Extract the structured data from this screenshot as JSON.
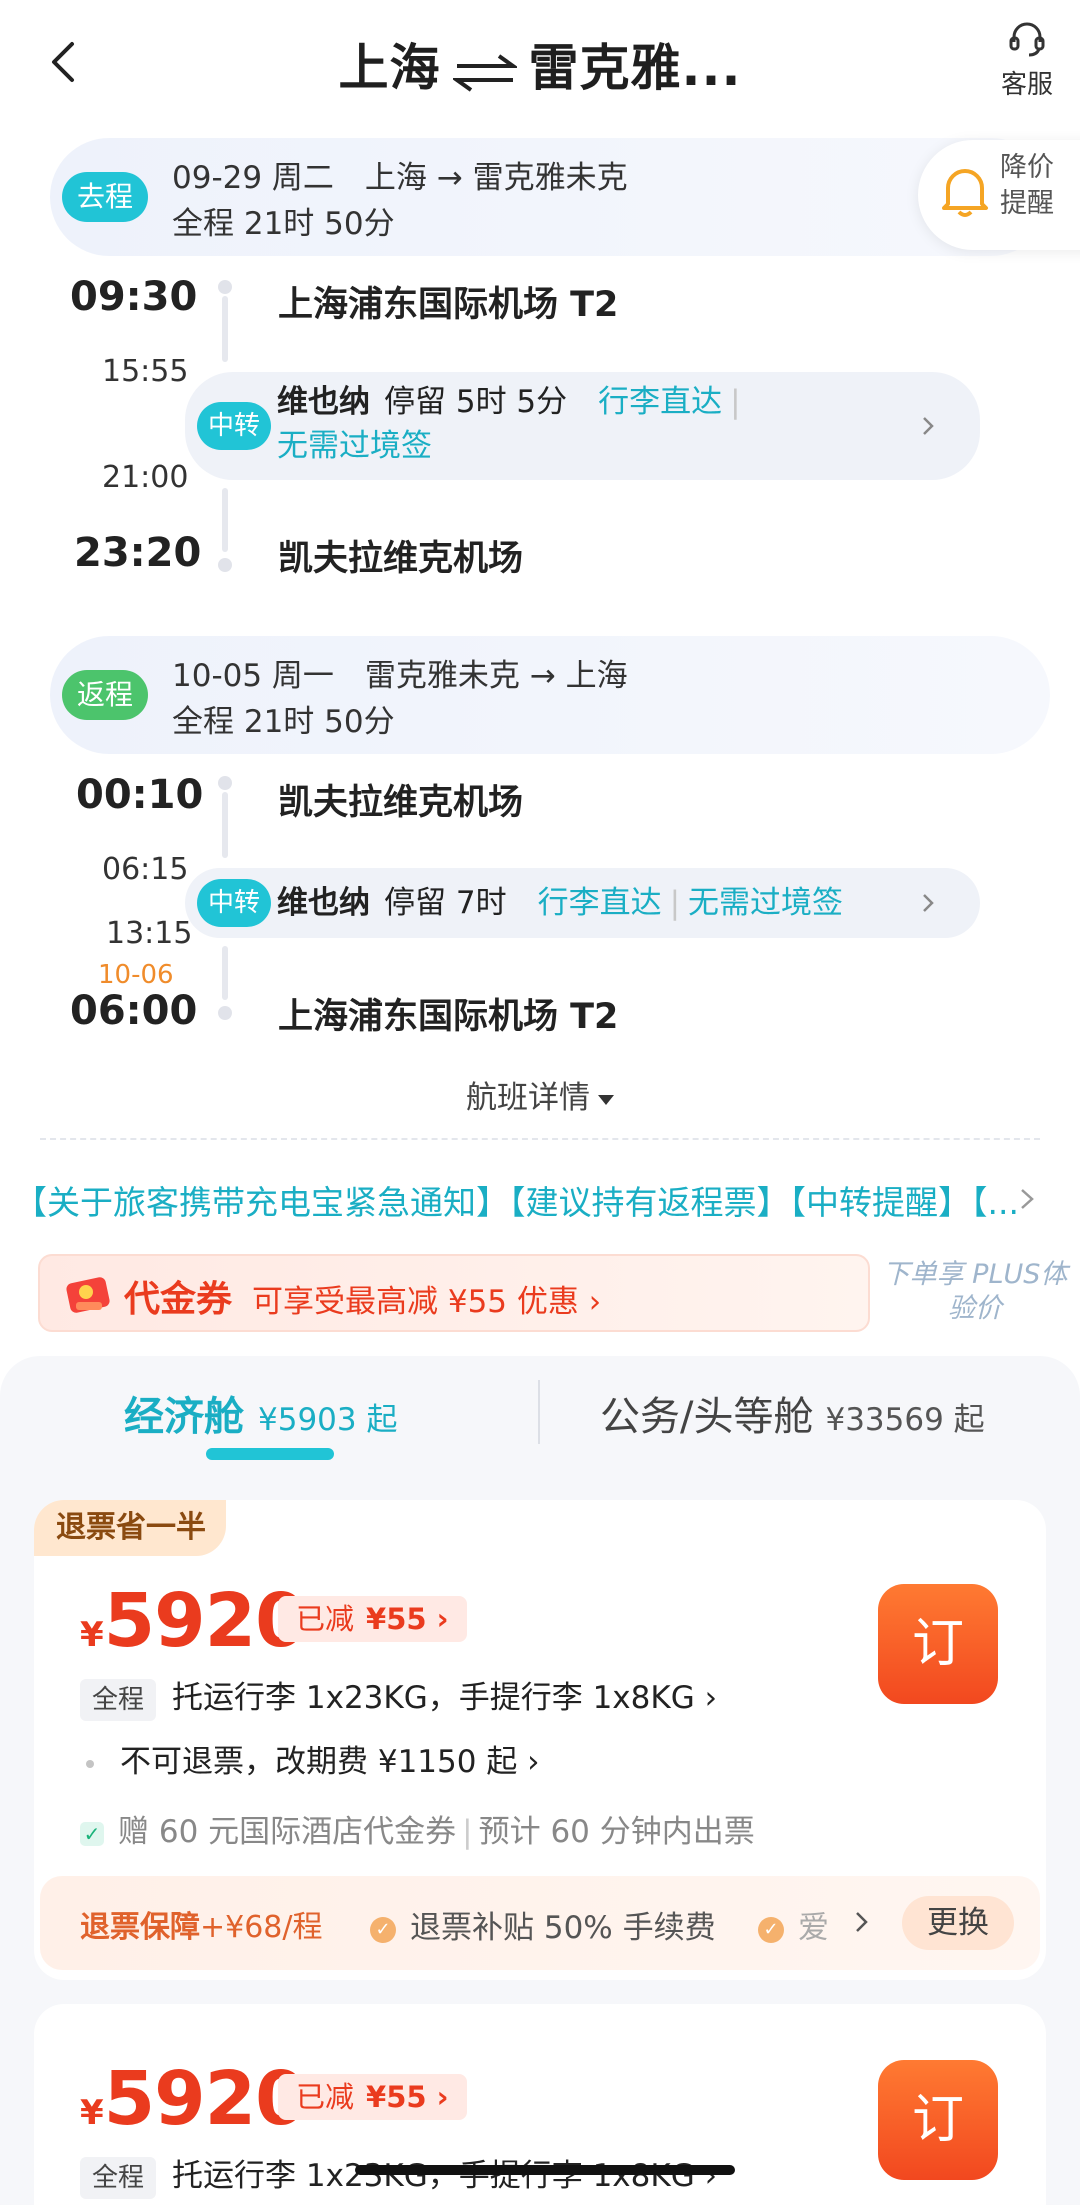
{
  "header": {
    "title_from": "上海",
    "title_to": "雷克雅...",
    "service_label": "客服"
  },
  "price_alert": {
    "label": "降价提醒"
  },
  "outbound": {
    "badge": "去程",
    "line1": "09-29 周二　上海 → 雷克雅未克",
    "line2": "全程 21时 50分",
    "depart_time": "09:30",
    "depart_airport": "上海浦东国际机场 T2",
    "arrive_transfer": "15:55",
    "leave_transfer": "21:00",
    "transfer": {
      "badge": "中转",
      "city": "维也纳",
      "stay": "停留 5时 5分",
      "luggage": "行李直达",
      "visa": "无需过境签"
    },
    "arrive_time": "23:20",
    "arrive_airport": "凯夫拉维克机场"
  },
  "return": {
    "badge": "返程",
    "line1": "10-05 周一　雷克雅未克 → 上海",
    "line2": "全程 21时 50分",
    "depart_time": "00:10",
    "depart_airport": "凯夫拉维克机场",
    "arrive_transfer": "06:15",
    "leave_transfer": "13:15",
    "transfer": {
      "badge": "中转",
      "city": "维也纳",
      "stay": "停留 7时",
      "luggage": "行李直达",
      "visa": "无需过境签"
    },
    "arrive_date": "10-06",
    "arrive_time": "06:00",
    "arrive_airport": "上海浦东国际机场 T2"
  },
  "flight_detail": "航班详情",
  "notice": "【关于旅客携带充电宝紧急通知】【建议持有返程票】【中转提醒】【...",
  "coupon": {
    "label": "代金券",
    "desc": "可享受最高减 ¥55 优惠 ›",
    "plus": "下单享 PLUS体验价"
  },
  "cabins": {
    "economy": {
      "label": "经济舱",
      "price": "¥5903 起"
    },
    "business": {
      "label": "公务/头等舱",
      "price": "¥33569 起"
    }
  },
  "fares": [
    {
      "tag": "退票省一半",
      "currency": "¥",
      "price": "5920",
      "reduced_label": "已减",
      "reduced_value": "¥55 ›",
      "book": "订",
      "scope": "全程",
      "luggage": "托运行李 1x23KG，手提行李 1x8KG ›",
      "refund": "不可退票，改期费 ¥1150 起 ›",
      "gift": "赠 60 元国际酒店代金券",
      "ticketing": "预计 60 分钟内出票",
      "guard_label": "退票保障",
      "guard_price": "+¥68",
      "guard_unit": "/程",
      "guard_item1": "退票补贴 50% 手续费",
      "guard_item2": "爱",
      "change": "更换"
    },
    {
      "currency": "¥",
      "price": "5920",
      "reduced_label": "已减",
      "reduced_value": "¥55 ›",
      "book": "订",
      "scope": "全程",
      "luggage": "托运行李 1x23KG，手提行李 1x8KG ›"
    }
  ],
  "colors": {
    "accent": "#21c4d6",
    "price": "#ea3b1e",
    "return_badge": "#4cc46c",
    "book": "#f2481f"
  }
}
